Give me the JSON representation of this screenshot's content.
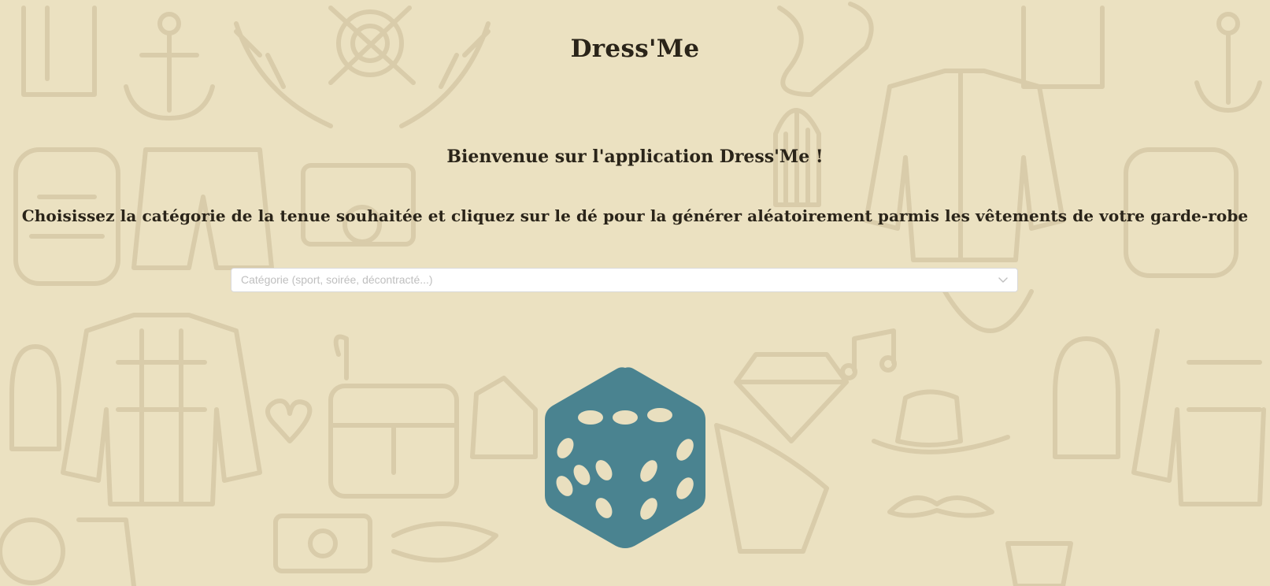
{
  "app": {
    "title": "Dress'Me"
  },
  "main": {
    "welcome": "Bienvenue sur l'application Dress'Me !",
    "instructions": "Choisissez la catégorie de la tenue souhaitée et cliquez sur le dé pour la générer aléatoirement parmis les vêtements de votre garde-robe"
  },
  "category_select": {
    "placeholder": "Catégorie (sport, soirée, décontracté...)",
    "selected_value": "",
    "icon": "chevron-down-icon"
  },
  "dice": {
    "icon": "dice-icon"
  },
  "colors": {
    "background": "#ebe1c1",
    "pattern": "#d9ccaa",
    "text": "#2a2419",
    "dice": "#4a8390",
    "dice_pips": "#e9dfbf"
  }
}
